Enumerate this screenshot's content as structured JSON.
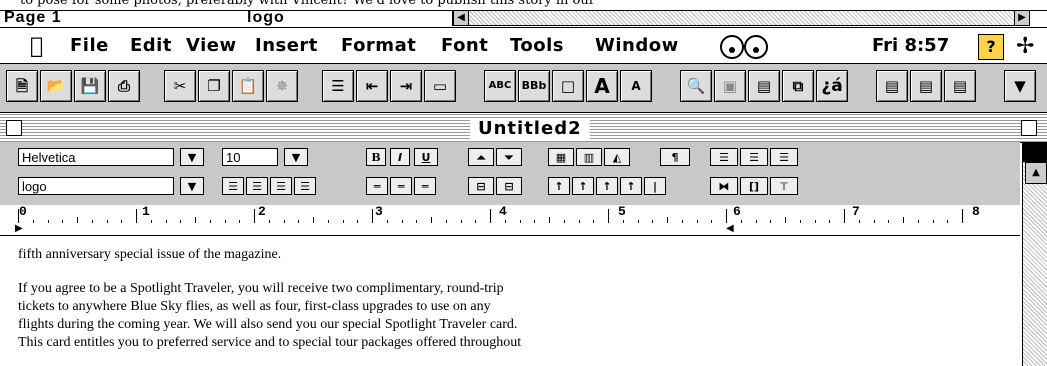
{
  "back_window": {
    "text_line": "to pose for some photos, preferably with Vincent? We'd love to publish this story in our",
    "page_label": "Page 1",
    "style_label": "logo"
  },
  "menubar": {
    "items": [
      "File",
      "Edit",
      "View",
      "Insert",
      "Format",
      "Font",
      "Tools",
      "Window"
    ],
    "clock": "Fri 8:57"
  },
  "toolbar": {
    "icons": [
      "new-doc-icon",
      "open-icon",
      "save-icon",
      "print-icon",
      "cut-icon",
      "copy-icon",
      "paste-icon",
      "format-painter-icon",
      "bullets-icon",
      "decrease-indent-icon",
      "increase-indent-icon",
      "frame-icon",
      "spellcheck-icon",
      "bbb-icon",
      "border-icon",
      "grow-font-icon",
      "shrink-font-icon",
      "find-icon",
      "insert-picture-icon",
      "document-icon",
      "duplicate-icon",
      "spanish-icon",
      "page-view-1-icon",
      "page-view-2-icon",
      "page-view-3-icon",
      "dropdown-icon"
    ],
    "spell_label": "ABC",
    "bbb_label": "BBb",
    "grow_label": "A",
    "shrink_label": "A",
    "spanish_label": "¿á"
  },
  "document": {
    "title": "Untitled2",
    "font_name": "Helvetica",
    "font_size": "10",
    "style_name": "logo",
    "bold_label": "B",
    "italic_label": "I",
    "underline_label": "U",
    "ruler_numbers": [
      "0",
      "1",
      "2",
      "3",
      "4",
      "5",
      "6",
      "7",
      "8"
    ],
    "paragraphs": [
      "fifth anniversary special issue of the magazine.",
      "If you agree to be a Spotlight Traveler, you will receive two complimentary, round-trip",
      "tickets to anywhere Blue Sky flies, as well as four, first-class upgrades to use on any",
      "flights during the coming year. We will also send you our special Spotlight Traveler card.",
      "This card entitles you to preferred service and to special tour packages offered throughout"
    ]
  }
}
